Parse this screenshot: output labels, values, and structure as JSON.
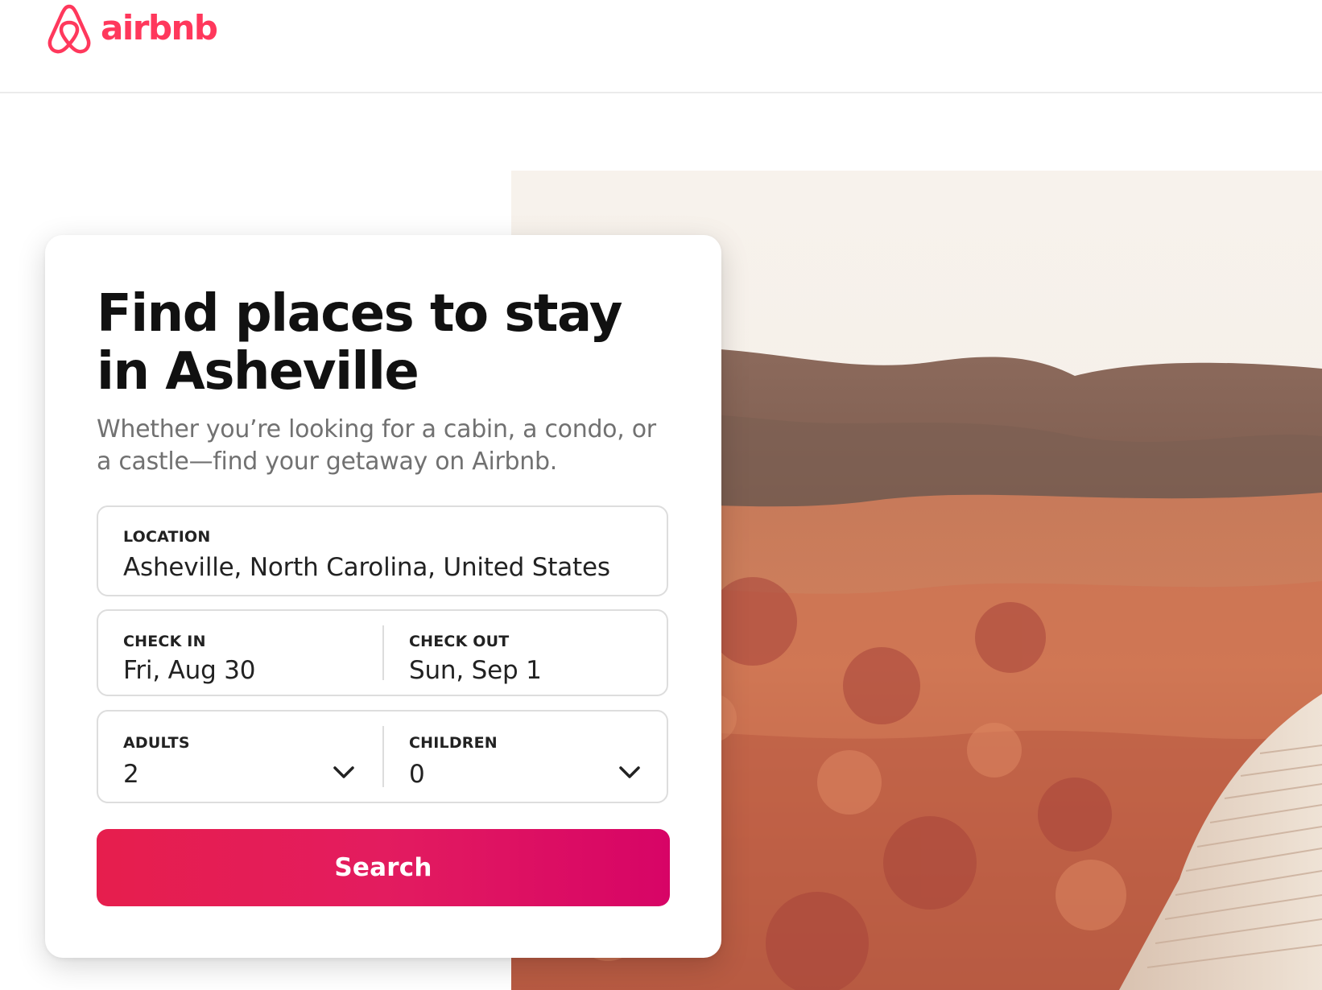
{
  "brand": {
    "name": "airbnb",
    "color": "#FF385C",
    "logo_icon": "airbnb-belo-icon"
  },
  "hero_image": {
    "subject": "autumn meadow with boardwalk and hills"
  },
  "card": {
    "title": "Find places to stay in Asheville",
    "subtitle": "Whether you’re looking for a cabin, a condo, or a castle—find your getaway on Airbnb.",
    "location": {
      "label": "LOCATION",
      "value": "Asheville, North Carolina, United States"
    },
    "check_in": {
      "label": "CHECK IN",
      "value": "Fri, Aug 30"
    },
    "check_out": {
      "label": "CHECK OUT",
      "value": "Sun, Sep 1"
    },
    "adults": {
      "label": "ADULTS",
      "value": "2",
      "icon": "chevron-down-icon"
    },
    "children": {
      "label": "CHILDREN",
      "value": "0",
      "icon": "chevron-down-icon"
    },
    "search_label": "Search",
    "search_colors": [
      "#E61E4D",
      "#E31C5F",
      "#D70466"
    ]
  }
}
